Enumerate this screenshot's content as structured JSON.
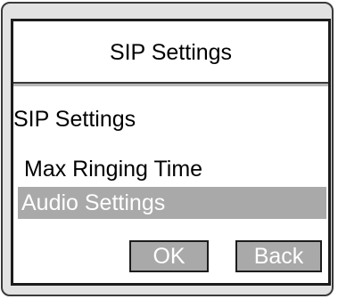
{
  "title_bar": {
    "title": "SIP Settings"
  },
  "menu": {
    "items": [
      {
        "label": "SIP Settings",
        "selected": false
      },
      {
        "label": "Max Ringing Time",
        "selected": false
      },
      {
        "label": "Audio Settings",
        "selected": true
      }
    ]
  },
  "softkeys": {
    "ok_label": "OK",
    "back_label": "Back"
  },
  "colors": {
    "highlight": "#a9a9a9",
    "highlight_text": "#ffffff",
    "screen_bg": "#ffffff",
    "device_bg": "#e2e2e2",
    "border": "#1c1c1c"
  }
}
